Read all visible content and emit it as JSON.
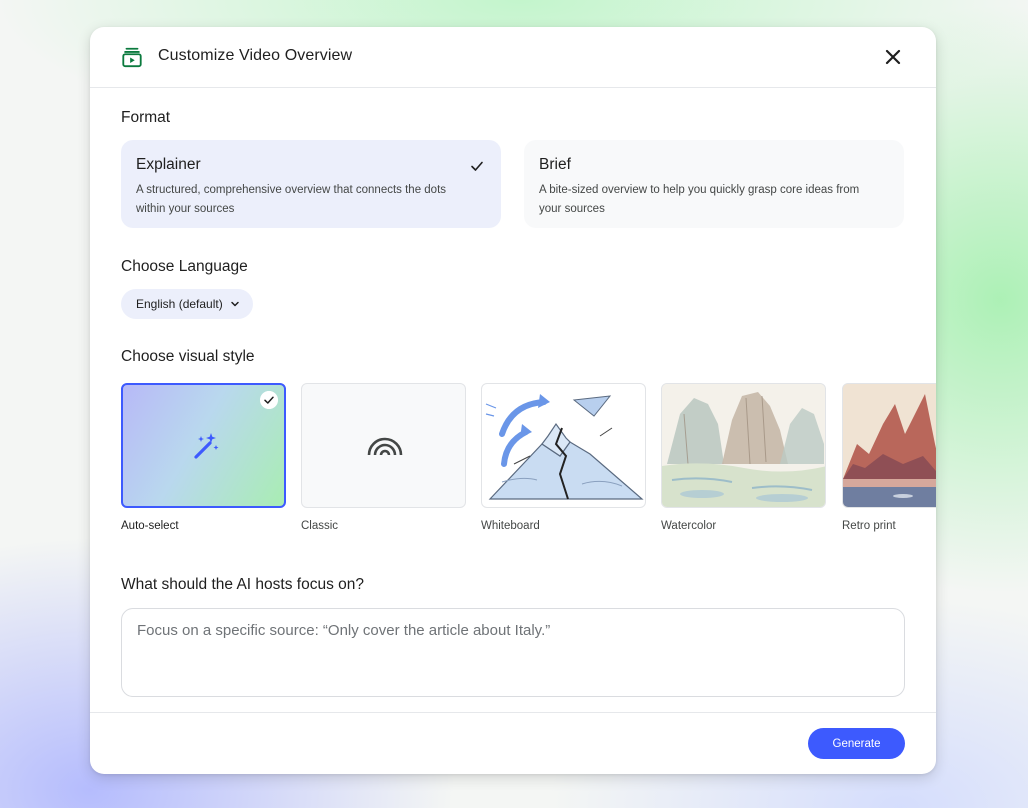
{
  "dialog": {
    "title": "Customize Video Overview",
    "header_icon": "video-overview-icon",
    "close_icon": "close-icon"
  },
  "format": {
    "label": "Format",
    "options": [
      {
        "title": "Explainer",
        "description": "A structured, comprehensive overview that connects the dots within your sources",
        "selected": true
      },
      {
        "title": "Brief",
        "description": "A bite-sized overview to help you quickly grasp core ideas from your sources",
        "selected": false
      }
    ]
  },
  "language": {
    "label": "Choose Language",
    "selected": "English (default)"
  },
  "visual_style": {
    "label": "Choose visual style",
    "options": [
      {
        "label": "Auto-select",
        "selected": true
      },
      {
        "label": "Classic",
        "selected": false
      },
      {
        "label": "Whiteboard",
        "selected": false
      },
      {
        "label": "Watercolor",
        "selected": false
      },
      {
        "label": "Retro print",
        "selected": false
      }
    ]
  },
  "focus": {
    "label": "What should the AI hosts focus on?",
    "placeholder": "Focus on a specific source: “Only cover the article about Italy.”"
  },
  "footer": {
    "generate_label": "Generate"
  },
  "colors": {
    "accent": "#3d5afe",
    "selected_card_bg": "#eceffb"
  }
}
